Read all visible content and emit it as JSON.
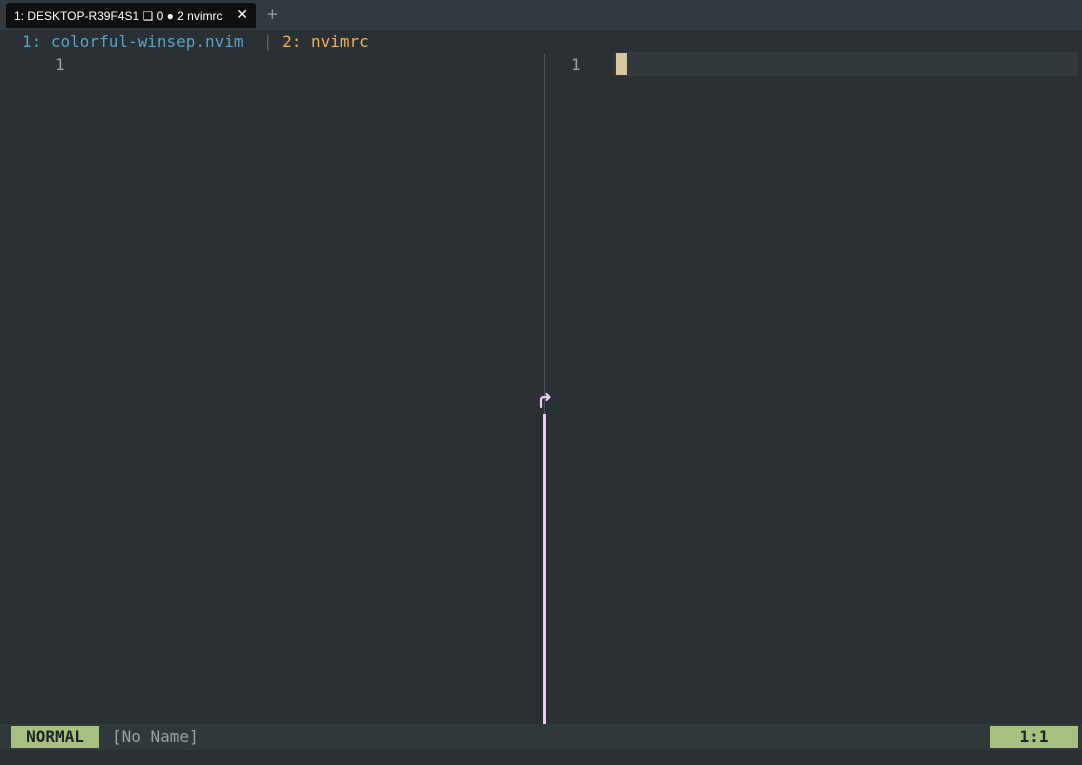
{
  "terminal": {
    "tab_title": "1: DESKTOP-R39F4S1 ❏ 0 ● 2 nvimrc",
    "tab_close": "✕",
    "new_tab": "+"
  },
  "nvim": {
    "tabline": {
      "tab1": "1: colorful-winsep.nvim",
      "separator": "|",
      "tab2": "2: nvimrc"
    },
    "left_window": {
      "line_numbers": [
        "1"
      ]
    },
    "right_window": {
      "line_numbers": [
        "1"
      ]
    },
    "statusline": {
      "mode": "NORMAL",
      "filename": "[No Name]",
      "position": "1:1"
    },
    "icons": {
      "separator_arrow": "arrow-turn-icon"
    },
    "colors": {
      "background": "#2a3034",
      "active_separator": "#e8ccf2",
      "mode_bg": "#a5c07f",
      "tab1": "#5aa3c2",
      "tab2": "#e7b25c",
      "cursor": "#d8c79e"
    }
  }
}
